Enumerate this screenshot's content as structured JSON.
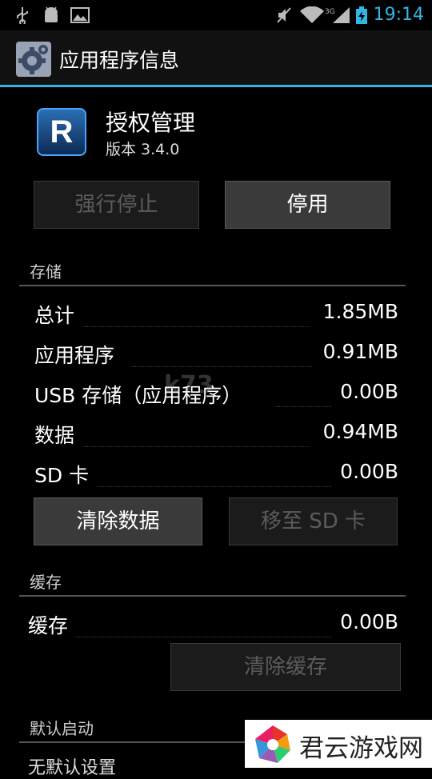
{
  "status_bar": {
    "time": "19:14"
  },
  "action_bar": {
    "title": "应用程序信息"
  },
  "app": {
    "icon_letter": "R",
    "name": "授权管理",
    "version": "版本 3.4.0"
  },
  "buttons": {
    "force_stop": "强行停止",
    "disable": "停用"
  },
  "storage": {
    "title": "存储",
    "rows": [
      {
        "label": "总计",
        "value": "1.85MB"
      },
      {
        "label": "应用程序",
        "value": "0.91MB"
      },
      {
        "label": "USB 存储（应用程序）",
        "value": "0.00B"
      },
      {
        "label": "数据",
        "value": "0.94MB"
      },
      {
        "label": "SD 卡",
        "value": "0.00B"
      }
    ],
    "clear_data": "清除数据",
    "move_to_sd": "移至 SD 卡"
  },
  "cache": {
    "title": "缓存",
    "label": "缓存",
    "value": "0.00B",
    "clear_cache": "清除缓存"
  },
  "launch": {
    "title": "默认启动",
    "no_defaults": "无默认设置"
  },
  "watermark": {
    "badge_text": "君云游戏网",
    "center_text": "k73"
  },
  "colors": {
    "accent": "#33b5e5",
    "background": "#000000"
  }
}
